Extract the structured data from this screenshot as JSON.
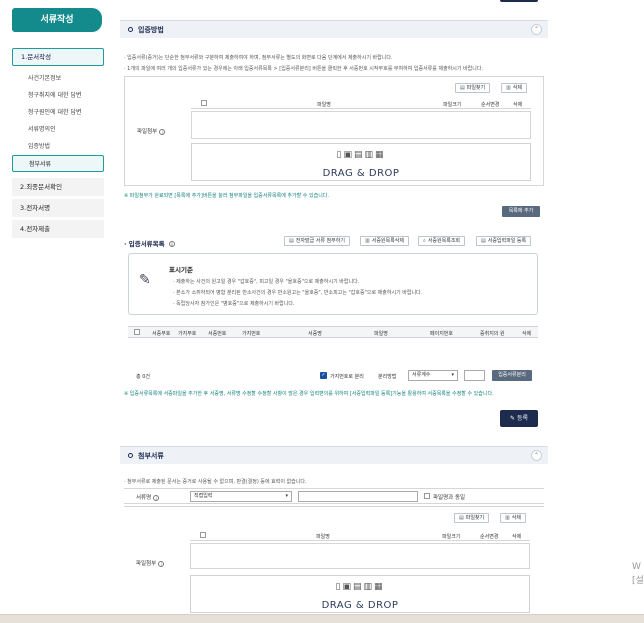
{
  "sidebar": {
    "title": "서류작성",
    "steps": [
      {
        "label": "1.문서작성"
      },
      {
        "label": "2.최종문서확인"
      },
      {
        "label": "3.전자서명"
      },
      {
        "label": "4.전자제출"
      }
    ],
    "sub_items": [
      {
        "label": "사건기본정보"
      },
      {
        "label": "청구취지에 대한 답변"
      },
      {
        "label": "청구원인에 대한 답변"
      },
      {
        "label": "서류명의인"
      },
      {
        "label": "입증방법"
      },
      {
        "label": "첨부서류"
      }
    ]
  },
  "section1": {
    "title": "입증방법",
    "note1": "· 입증서류(증거)는 단순한 첨부서류와 구분하여 제출하여야 하며, 첨부서류는 별도의 화면로 다음 단계에서 제출하시기 바랍니다.",
    "note2": "· 1개의 파일에 여러 개의 입증서류가 있는 경우에는 아래 입증서류목록 > [입증서류분리] 버튼을 클릭한 후 서증번호 시작부호를 부여하여 입증서류를 제출하시기 바랍니다.",
    "file_label": "파일첨부",
    "btn_find": "파일찾기",
    "btn_delete": "삭제",
    "col_filename": "파일명",
    "col_size": "파일크기",
    "col_order": "순서변경",
    "col_del": "삭제",
    "drag": "DRAG & DROP",
    "green_note": "※ 파일첨부가 완료되면 [목록에 추가]버튼을 눌러 첨부파일을 입증서류목록에 추가할 수 있습니다.",
    "btn_add_list": "목록에 추가"
  },
  "list": {
    "title": "· 입증서류목록",
    "info_icon": "ⓘ",
    "btn_ref": "전자발급 서류 첨부하기",
    "btn_del_list": "서증원목록삭제",
    "btn_view": "서증원목록조회",
    "btn_reg": "서증입력파일 등록",
    "std_title": "표시기준",
    "std_lines": [
      "· 제출하는 사건의 원고일 경우 \"갑호증\", 피고일 경우 \"을호증\"으로 제출하시기 바랍니다.",
      "· 본소가 소취하되어 병합 분리된 반소사건의 경우 반소원고는 \"을호증\", 반소피고는 \"갑호증\"으로 제출하시기 바랍니다.",
      "· 독립당사자 참가인은 \"병호증\"으로 제출하시기 바랍니다."
    ],
    "headers": [
      "서증부호",
      "가지부호",
      "서증번호",
      "가지번호",
      "서증명",
      "파일명",
      "페이지번호",
      "증취지의 원",
      "삭제"
    ],
    "total": "총 0건",
    "branch_label": "가지번호로 분리",
    "split_label": "분리방법",
    "split_value": "서류계수",
    "btn_split": "입증서류분리",
    "green_note": "※ 입증서류목록에 서증파일을 추가한 후 서증명, 서류명 수정할 수정할 사항이 많은 경우 입력편의를 위하여 [서증입력파일 등록]기능을 활용하여 서증목록을 수정할 수 있습니다.",
    "btn_register": "등록"
  },
  "section2": {
    "title": "첨부서류",
    "note": "· 첨부서류로 제출된 문서는 증거로 사용될 수 없으며, 판결(결정) 등에 효력이 없습니다.",
    "doc_label": "서류명",
    "doc_select": "직접입력",
    "same_file_label": "파일명과 동일",
    "file_label": "파일첨부",
    "btn_find": "파일찾기",
    "btn_delete": "삭제",
    "col_filename": "파일명",
    "col_size": "파일크기",
    "col_order": "순서변경",
    "col_del": "삭제",
    "drag": "DRAG & DROP"
  },
  "watermark": {
    "line1": "W",
    "line2": "[설"
  },
  "colors": {
    "teal": "#138a8b",
    "navy": "#1d2b4f",
    "green_text": "#11837f"
  }
}
